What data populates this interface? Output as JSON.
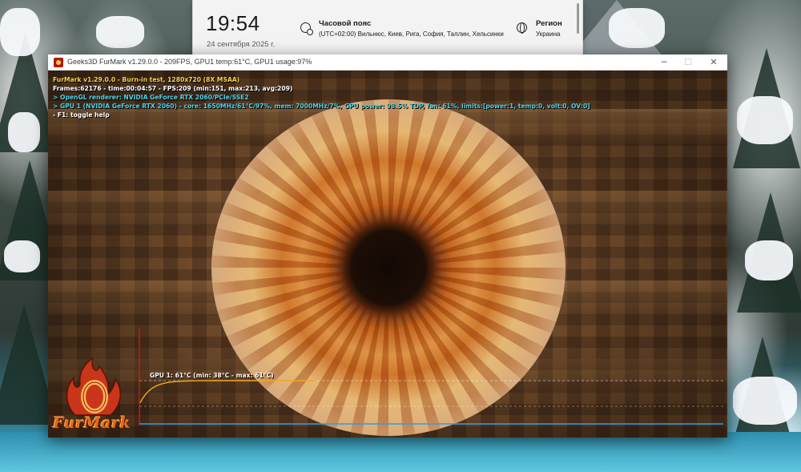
{
  "flyout": {
    "time": "19:54",
    "date": "24 сентября 2025 г.",
    "timezone_title": "Часовой пояс",
    "timezone_value": "(UTC+02:00) Вильнюс, Киев, Рига, София, Таллин, Хельсинки",
    "region_title": "Регион",
    "region_value": "Украина"
  },
  "window": {
    "title": "Geeks3D FurMark v1.29.0.0 - 209FPS, GPU1 temp:61°C, GPU1 usage:97%",
    "minimize": "─",
    "maximize": "☐",
    "close": "✕"
  },
  "osd": {
    "line1": "FurMark v1.29.0.0 - Burn-in test, 1280x720 (8X MSAA)",
    "line2": "Frames:62176 - time:00:04:57 - FPS:209 (min:151, max:213, avg:209)",
    "line3": "> OpenGL renderer: NVIDIA GeForce RTX 2060/PCIe/SSE2",
    "line4": "> GPU 1 (NVIDIA GeForce RTX 2060) - core: 1650MHz/61°C/97%, mem: 7000MHz/7%, GPU power: 98.5% TDP, fan: 61%, limits:[power:1, temp:0, volt:0, OV:0]",
    "line5": "- F1: toggle help"
  },
  "graph": {
    "label": "GPU 1: 61°C (min: 38°C - max: 61°C)",
    "min_c": 38,
    "max_c": 61,
    "current_c": 61,
    "line_color": "#f5a623",
    "baseline_color": "#3a9ad9"
  },
  "logo": {
    "text": "FurMark"
  },
  "colors": {
    "osd_title": "#ffd24a",
    "osd_info": "#4fd3e8",
    "osd_text": "#ffffff"
  }
}
